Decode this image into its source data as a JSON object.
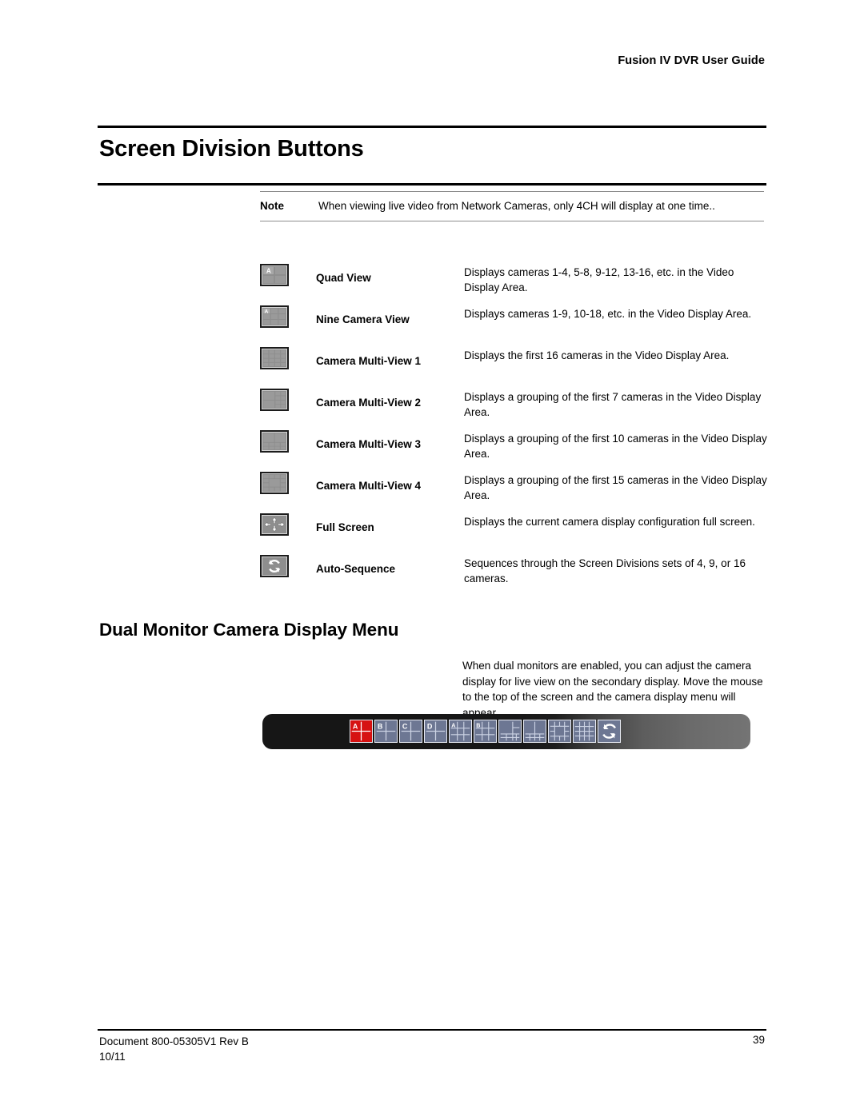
{
  "header": {
    "running_title": "Fusion IV DVR User Guide"
  },
  "section": {
    "h1": "Screen Division Buttons",
    "h2": "Dual Monitor Camera Display Menu"
  },
  "note": {
    "label": "Note",
    "text": "When viewing live video from Network Cameras, only 4CH will display at one time.."
  },
  "icon_table": {
    "rows": [
      {
        "icon": "quad-view-icon",
        "label": "Quad View",
        "description": "Displays cameras 1-4, 5-8, 9-12, 13-16, etc. in the Video Display Area."
      },
      {
        "icon": "nine-camera-view-icon",
        "label": "Nine Camera View",
        "description": "Displays cameras 1-9, 10-18, etc. in the Video Display Area."
      },
      {
        "icon": "camera-multi-view-1-icon",
        "label": "Camera Multi-View 1",
        "description": "Displays the first 16 cameras in the Video Display Area."
      },
      {
        "icon": "camera-multi-view-2-icon",
        "label": "Camera Multi-View 2",
        "description": "Displays a grouping of the first 7 cameras in the Video Display Area."
      },
      {
        "icon": "camera-multi-view-3-icon",
        "label": "Camera Multi-View 3",
        "description": "Displays a grouping of the first 10 cameras in the Video Display Area."
      },
      {
        "icon": "camera-multi-view-4-icon",
        "label": "Camera Multi-View 4",
        "description": "Displays a grouping of the first 15 cameras in the Video Display Area."
      },
      {
        "icon": "full-screen-icon",
        "label": "Full Screen",
        "description": "Displays the current camera display configuration full screen."
      },
      {
        "icon": "auto-sequence-icon",
        "label": "Auto-Sequence",
        "description": "Sequences through the Screen Divisions sets of 4, 9, or 16 cameras."
      }
    ]
  },
  "body": {
    "paragraph": "When dual monitors are enabled, you can adjust the camera display for live view on the secondary display. Move the mouse to the top of the screen and the camera display menu will appear."
  },
  "dual_monitor_menu": {
    "buttons": [
      {
        "name": "quad-view-a-button",
        "badge": "A",
        "selected": true
      },
      {
        "name": "quad-view-b-button",
        "badge": "B",
        "selected": false
      },
      {
        "name": "quad-view-c-button",
        "badge": "C",
        "selected": false
      },
      {
        "name": "quad-view-d-button",
        "badge": "D",
        "selected": false
      },
      {
        "name": "nine-camera-view-a-button",
        "badge": "A",
        "selected": false
      },
      {
        "name": "nine-camera-view-b-button",
        "badge": "B",
        "selected": false
      },
      {
        "name": "camera-multi-view-2-button",
        "badge": "",
        "selected": false
      },
      {
        "name": "camera-multi-view-3-button",
        "badge": "",
        "selected": false
      },
      {
        "name": "camera-multi-view-4-button",
        "badge": "",
        "selected": false
      },
      {
        "name": "camera-multi-view-1-button",
        "badge": "",
        "selected": false
      },
      {
        "name": "auto-sequence-button",
        "badge": "",
        "selected": false
      }
    ]
  },
  "footer": {
    "document_line1": "Document 800-05305V1 Rev B",
    "document_line2": "10/11",
    "page_number": "39"
  },
  "colors": {
    "accent_selected": "#d61212",
    "button_face": "#6d7793",
    "toolbar_dark": "#161616",
    "rule": "#000000"
  }
}
